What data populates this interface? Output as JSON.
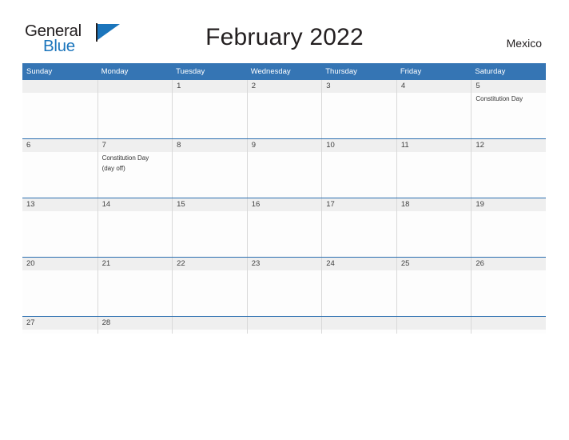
{
  "brand": {
    "name_part1": "General",
    "name_part2": "Blue",
    "flag_icon": "blue-flag-triangle"
  },
  "header": {
    "title": "February 2022",
    "country": "Mexico"
  },
  "colors": {
    "header_blue": "#3575b4",
    "row_separator_blue": "#2c6fb0",
    "daynum_band": "#efefef",
    "brand_blue": "#1b75bc",
    "text_dark": "#231f20"
  },
  "calendar": {
    "weekday_headers": [
      "Sunday",
      "Monday",
      "Tuesday",
      "Wednesday",
      "Thursday",
      "Friday",
      "Saturday"
    ],
    "weeks": [
      [
        {
          "day": "",
          "events": []
        },
        {
          "day": "",
          "events": []
        },
        {
          "day": "1",
          "events": []
        },
        {
          "day": "2",
          "events": []
        },
        {
          "day": "3",
          "events": []
        },
        {
          "day": "4",
          "events": []
        },
        {
          "day": "5",
          "events": [
            "Constitution Day"
          ]
        }
      ],
      [
        {
          "day": "6",
          "events": []
        },
        {
          "day": "7",
          "events": [
            "Constitution Day",
            "(day off)"
          ]
        },
        {
          "day": "8",
          "events": []
        },
        {
          "day": "9",
          "events": []
        },
        {
          "day": "10",
          "events": []
        },
        {
          "day": "11",
          "events": []
        },
        {
          "day": "12",
          "events": []
        }
      ],
      [
        {
          "day": "13",
          "events": []
        },
        {
          "day": "14",
          "events": []
        },
        {
          "day": "15",
          "events": []
        },
        {
          "day": "16",
          "events": []
        },
        {
          "day": "17",
          "events": []
        },
        {
          "day": "18",
          "events": []
        },
        {
          "day": "19",
          "events": []
        }
      ],
      [
        {
          "day": "20",
          "events": []
        },
        {
          "day": "21",
          "events": []
        },
        {
          "day": "22",
          "events": []
        },
        {
          "day": "23",
          "events": []
        },
        {
          "day": "24",
          "events": []
        },
        {
          "day": "25",
          "events": []
        },
        {
          "day": "26",
          "events": []
        }
      ],
      [
        {
          "day": "27",
          "events": []
        },
        {
          "day": "28",
          "events": []
        },
        {
          "day": "",
          "events": []
        },
        {
          "day": "",
          "events": []
        },
        {
          "day": "",
          "events": []
        },
        {
          "day": "",
          "events": []
        },
        {
          "day": "",
          "events": []
        }
      ]
    ]
  }
}
